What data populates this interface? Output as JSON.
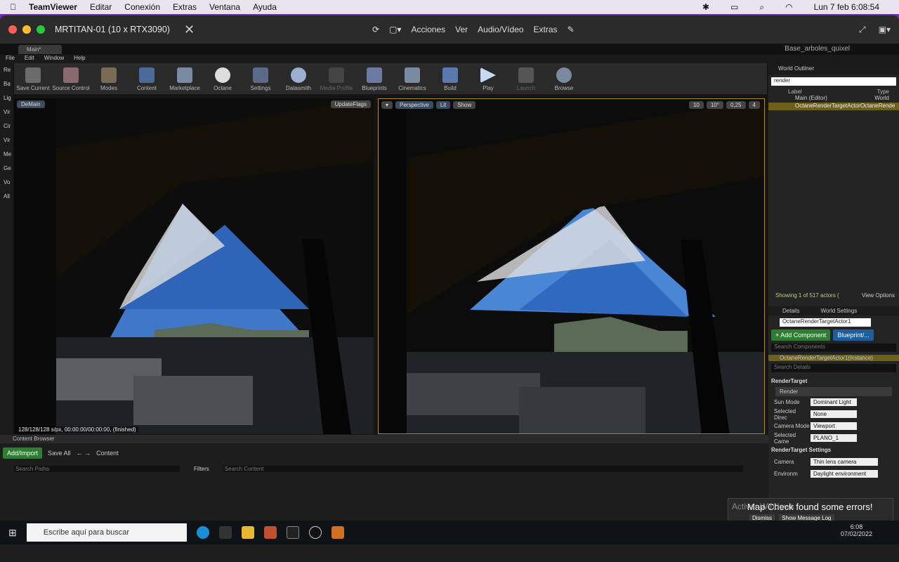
{
  "mac": {
    "app": "TeamViewer",
    "menus": [
      "Editar",
      "Conexión",
      "Extras",
      "Ventana",
      "Ayuda"
    ],
    "clock": "Lun 7 feb  6:08:54"
  },
  "tv": {
    "title": "MRTITAN-01 (10 x RTX3090)",
    "actions": [
      "Acciones",
      "Ver",
      "Audio/Vídeo",
      "Extras"
    ]
  },
  "ue": {
    "tab": "Main*",
    "project": "Base_arboles_quixel",
    "menu": [
      "File",
      "Edit",
      "Window",
      "Help"
    ],
    "toolbar": [
      "Save Current",
      "Source Control",
      "Modes",
      "Content",
      "Marketplace",
      "Octane",
      "Settings",
      "Datasmith",
      "Media Profile",
      "Blueprints",
      "Cinematics",
      "Build",
      "Play",
      "Launch",
      "Browse"
    ],
    "left_tabs": [
      "Re",
      "Ba",
      "Lig",
      "Vir",
      "Cir",
      "Vir",
      "Me",
      "Ge",
      "Vo",
      "All"
    ],
    "vp1": {
      "label": "DeMain",
      "flags": "UpdateFlags",
      "status": "128/128/128 s/px, 00:00:00/00:00:00, (finished)"
    },
    "vp2": {
      "perspective": "Perspective",
      "lit": "Lit",
      "show": "Show",
      "snap1": "10",
      "snap2": "10°",
      "scale": "0,25",
      "speed": "4"
    },
    "outliner": {
      "title": "World Outliner",
      "search": "render",
      "col_label": "Label",
      "col_type": "Type",
      "rows": [
        {
          "label": "Main (Editor)",
          "type": "World"
        },
        {
          "label": "OctaneRenderTargetActorOctaneRende",
          "type": ""
        }
      ],
      "showing": "Showing 1 of 517 actors (",
      "view_options": "View Options"
    },
    "details": {
      "tab1": "Details",
      "tab2": "World Settings",
      "actor": "OctaneRenderTargetActor1",
      "add": "+ Add Component",
      "bp": "Blueprint/...",
      "search_comp": "Search Components",
      "instance": "OctaneRenderTargetActor1(Instance)",
      "search_det": "Search Details",
      "section1": "RenderTarget",
      "render": "Render",
      "props": [
        {
          "k": "Sun Mode",
          "v": "Dominant Light"
        },
        {
          "k": "Selected Direc",
          "v": "None"
        },
        {
          "k": "Camera Mode",
          "v": "Viewport"
        },
        {
          "k": "Selected Came",
          "v": "PLANO_1"
        }
      ],
      "section2": "RenderTarget Settings",
      "camera_k": "Camera",
      "camera_v": "Thin lens camera",
      "env_k": "Environm",
      "env_v": "Daylight environment"
    },
    "content_browser": {
      "tab": "Content Browser",
      "add": "Add/Import",
      "save": "Save All",
      "path": "Content",
      "search_paths": "Search Paths",
      "filters": "Filters",
      "search_content": "Search Content"
    },
    "toast": {
      "title": "Map Check found some errors!",
      "dismiss": "Dismiss",
      "log": "Show Message Log"
    },
    "watermark": "Activar Windows"
  },
  "taskbar": {
    "search": "Escribe aquí para buscar",
    "time": "6:08",
    "date": "07/02/2022"
  }
}
